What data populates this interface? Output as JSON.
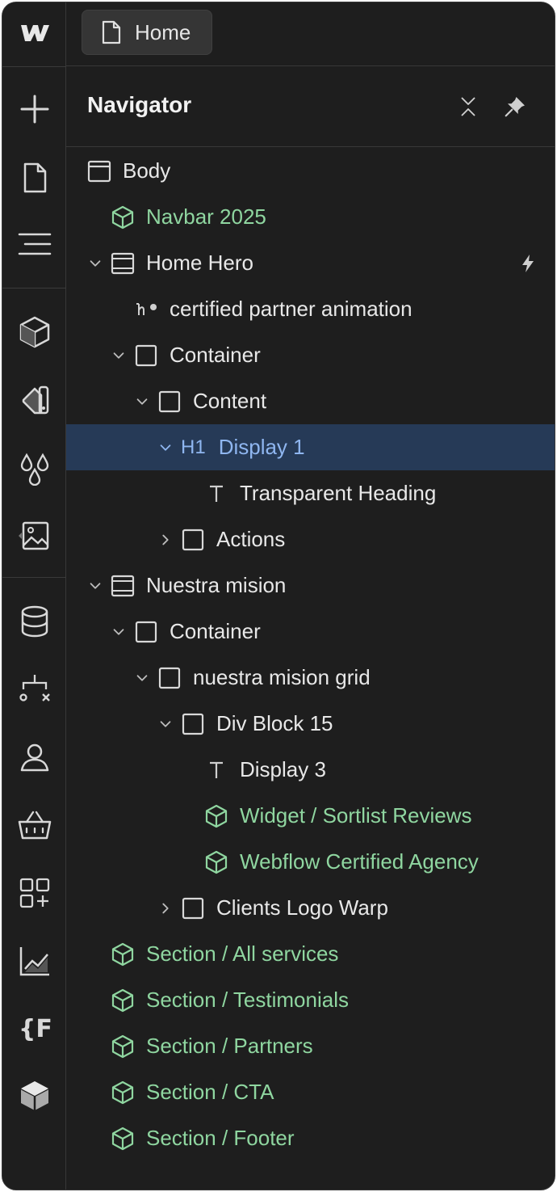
{
  "top_tab": {
    "label": "Home",
    "icon": "page-icon"
  },
  "panel": {
    "title": "Navigator",
    "collapse_icon": "collapse-all-icon",
    "pin_icon": "pin-icon"
  },
  "rail_icons": [
    "webflow-logo-icon",
    "add-icon",
    "pages-icon",
    "navigator-icon",
    "components-icon",
    "style-selector-icon",
    "variables-icon",
    "assets-icon",
    "cms-icon",
    "logic-icon",
    "users-icon",
    "ecommerce-icon",
    "apps-icon",
    "analyze-icon",
    "finsweet-icon",
    "relume-icon"
  ],
  "colors": {
    "background": "#1e1e1e",
    "component": "#8fd6a0",
    "selected_bg": "#263a57",
    "selected_text": "#8fb6f0"
  },
  "tree": [
    {
      "label": "Body",
      "icon": "body-icon",
      "depth": 0,
      "chevron": "none",
      "type": "element"
    },
    {
      "label": "Navbar 2025",
      "icon": "component-icon",
      "depth": 1,
      "chevron": "none",
      "type": "component"
    },
    {
      "label": "Home Hero",
      "icon": "section-icon",
      "depth": 1,
      "chevron": "down",
      "type": "element",
      "interaction": "bolt-icon"
    },
    {
      "label": "certified partner animation",
      "icon": "lottie-icon",
      "depth": 2,
      "chevron": "none",
      "type": "element"
    },
    {
      "label": "Container",
      "icon": "box-icon",
      "depth": 2,
      "chevron": "down",
      "type": "element"
    },
    {
      "label": "Content",
      "icon": "box-icon",
      "depth": 3,
      "chevron": "down",
      "type": "element"
    },
    {
      "label": "Display 1",
      "tag": "H1",
      "icon": "heading-icon",
      "depth": 4,
      "chevron": "down",
      "type": "selected"
    },
    {
      "label": "Transparent Heading",
      "icon": "text-icon",
      "depth": 5,
      "chevron": "none",
      "type": "element"
    },
    {
      "label": "Actions",
      "icon": "box-icon",
      "depth": 4,
      "chevron": "right",
      "type": "element"
    },
    {
      "label": "Nuestra mision",
      "icon": "section-icon",
      "depth": 1,
      "chevron": "down",
      "type": "element"
    },
    {
      "label": "Container",
      "icon": "box-icon",
      "depth": 2,
      "chevron": "down",
      "type": "element"
    },
    {
      "label": "nuestra mision grid",
      "icon": "box-icon",
      "depth": 3,
      "chevron": "down",
      "type": "element"
    },
    {
      "label": "Div Block 15",
      "icon": "box-icon",
      "depth": 4,
      "chevron": "down",
      "type": "element"
    },
    {
      "label": "Display 3",
      "icon": "text-icon",
      "depth": 5,
      "chevron": "none",
      "type": "element"
    },
    {
      "label": "Widget / Sortlist Reviews",
      "icon": "component-icon",
      "depth": 5,
      "chevron": "none",
      "type": "component"
    },
    {
      "label": "Webflow Certified Agency",
      "icon": "component-icon",
      "depth": 5,
      "chevron": "none",
      "type": "component"
    },
    {
      "label": "Clients Logo Warp",
      "icon": "box-icon",
      "depth": 4,
      "chevron": "right",
      "type": "element"
    },
    {
      "label": "Section / All services",
      "icon": "component-icon",
      "depth": 1,
      "chevron": "none",
      "type": "component"
    },
    {
      "label": "Section / Testimonials",
      "icon": "component-icon",
      "depth": 1,
      "chevron": "none",
      "type": "component"
    },
    {
      "label": "Section / Partners",
      "icon": "component-icon",
      "depth": 1,
      "chevron": "none",
      "type": "component"
    },
    {
      "label": "Section / CTA",
      "icon": "component-icon",
      "depth": 1,
      "chevron": "none",
      "type": "component"
    },
    {
      "label": "Section / Footer",
      "icon": "component-icon",
      "depth": 1,
      "chevron": "none",
      "type": "component"
    }
  ]
}
